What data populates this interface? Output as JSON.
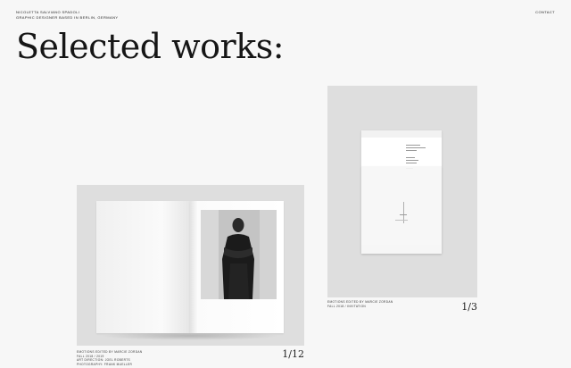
{
  "header": {
    "name_line": "Nicoletta Salviano Spadoli",
    "role_line": "Graphic designer based in Berlin, Germany",
    "contact_label": "Contact"
  },
  "main": {
    "title": "Selected works:"
  },
  "works": [
    {
      "caption": [
        "Emotions edited by Marcie Zordan",
        "Fall 2018 / 2019",
        "Art direction: Joel Roberts",
        "Photography: Frank Mueller"
      ],
      "counter": "1/12"
    },
    {
      "caption": [
        "Emotions edited by Marcie Zordan",
        "Fall 2018 / Invitation"
      ],
      "counter": "1/3"
    }
  ]
}
